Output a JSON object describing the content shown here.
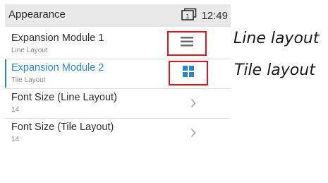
{
  "statusbar": {
    "title": "Appearance",
    "lock_digit": "1",
    "time": "12:49"
  },
  "rows": [
    {
      "label": "Expansion Module 1",
      "sub": "Line Layout",
      "icon": "list-lines-icon",
      "selected": false
    },
    {
      "label": "Expansion Module 2",
      "sub": "Tile Layout",
      "icon": "tiles-grid-icon",
      "selected": true
    },
    {
      "label": "Font Size (Line Layout)",
      "sub": "14",
      "icon": "chevron-right-icon"
    },
    {
      "label": "Font Size (Tile Layout)",
      "sub": "14",
      "icon": "chevron-right-icon"
    }
  ],
  "callouts": {
    "line": "Line layout",
    "tile": "Tile layout"
  },
  "colors": {
    "accent": "#2f86c7",
    "highlight_box": "#e0141f",
    "statusbar_bg": "#e9e9ea"
  }
}
